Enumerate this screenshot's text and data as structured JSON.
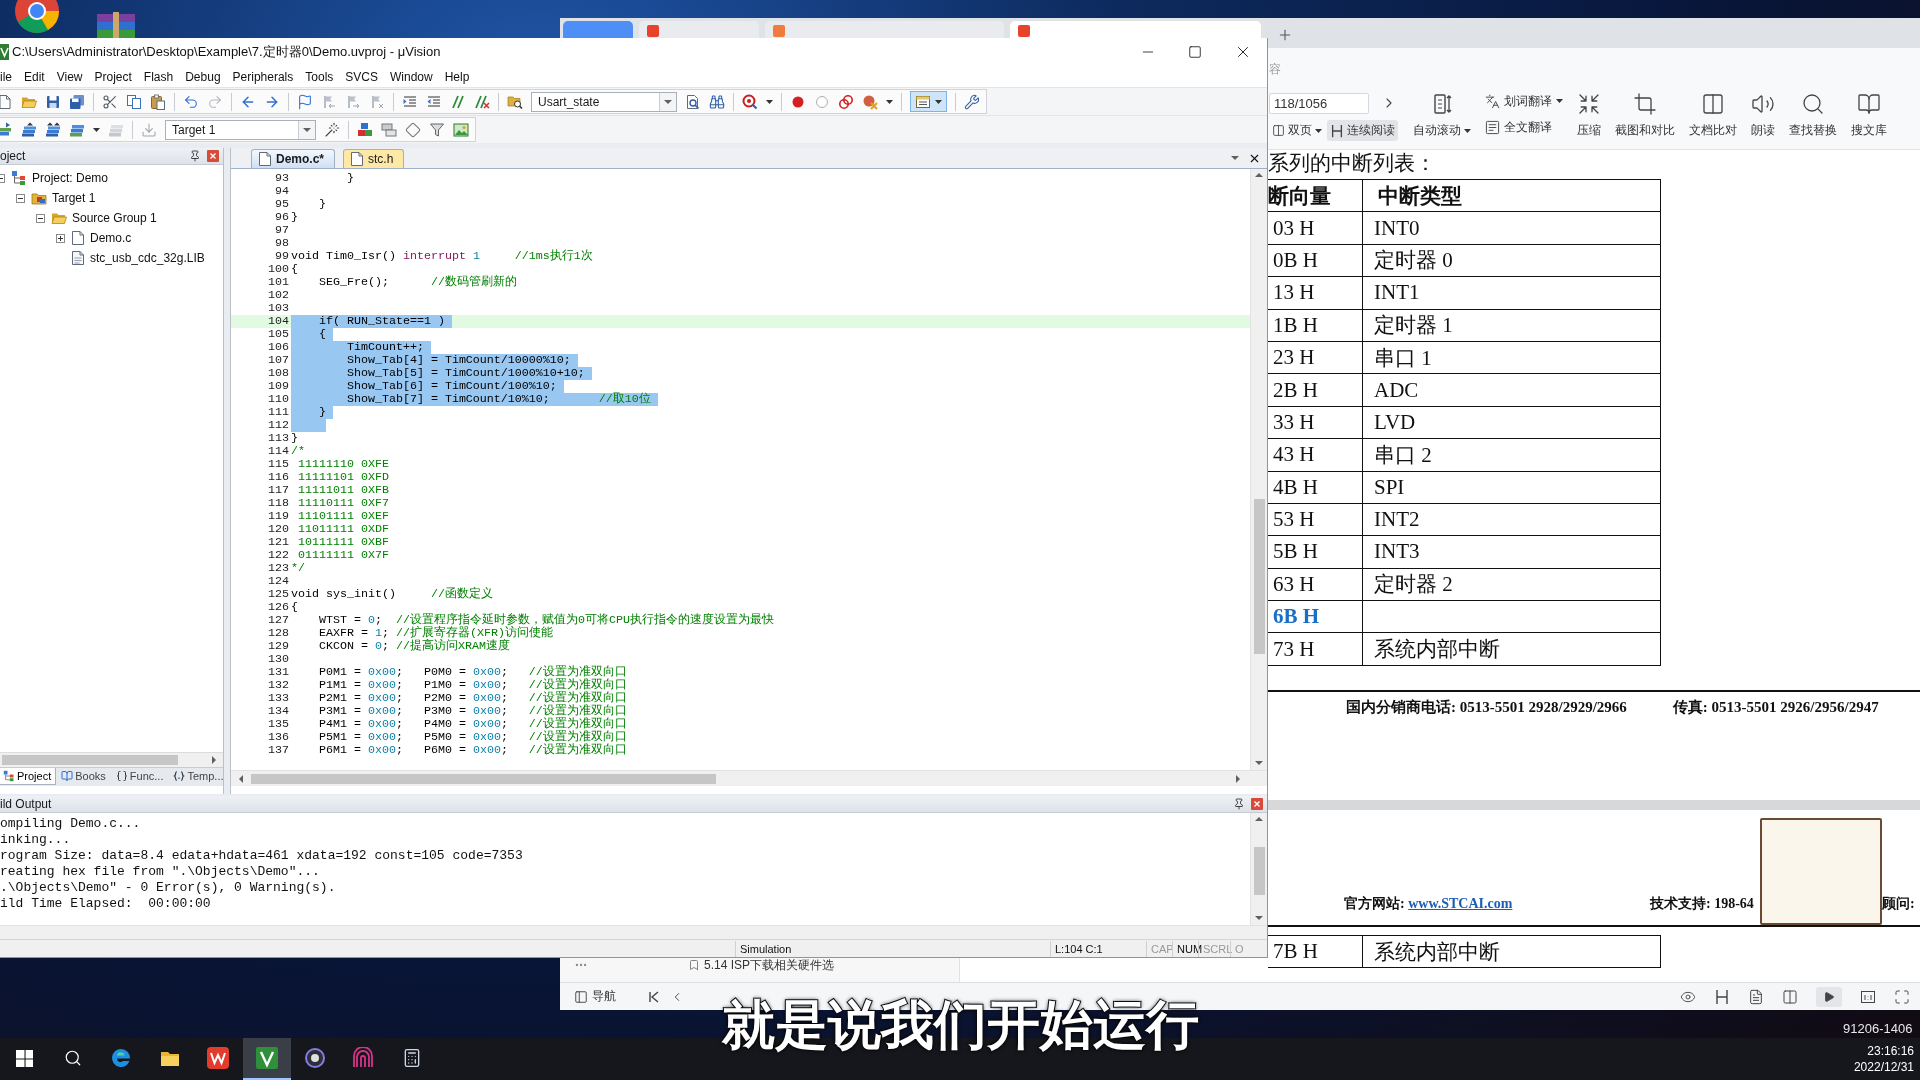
{
  "reader": {
    "tabs": [
      {
        "kind": "home",
        "selected": false
      },
      {
        "kind": "document",
        "color": "#e8412c",
        "selected": false
      },
      {
        "kind": "document",
        "color": "#f07b3f",
        "selected": false
      },
      {
        "kind": "document",
        "color": "#e8412c",
        "selected": true
      }
    ],
    "search_fragment": "容",
    "page_field": {
      "value": "118/1056"
    },
    "view_buttons": [
      {
        "label": "双页",
        "selected": false,
        "menu": true
      },
      {
        "label": "连续阅读",
        "selected": true,
        "menu": false
      }
    ],
    "tools": [
      {
        "kind": "large",
        "label": "自动滚动",
        "menu": true
      },
      {
        "kind": "small",
        "label": "划词翻译",
        "menu": true
      },
      {
        "kind": "small",
        "label": "全文翻译",
        "menu": false
      },
      {
        "kind": "large",
        "label": "压缩",
        "menu": false
      },
      {
        "kind": "large",
        "label": "截图和对比",
        "menu": false
      },
      {
        "kind": "large",
        "label": "文档比对",
        "menu": false
      },
      {
        "kind": "large",
        "label": "朗读",
        "menu": false
      },
      {
        "kind": "large",
        "label": "查找替换",
        "menu": false
      },
      {
        "kind": "large",
        "label": "搜文库",
        "menu": false
      }
    ],
    "outline": {
      "item": "5.14 ISP下载相关硬件选"
    },
    "page": {
      "heading": "系列的中断列表：",
      "columns": [
        "断向量",
        "中断类型"
      ],
      "rows": [
        {
          "vector": "03 H",
          "type": "INT0",
          "link": false
        },
        {
          "vector": "0B H",
          "type": "定时器 0",
          "link": false
        },
        {
          "vector": "13 H",
          "type": "INT1",
          "link": false
        },
        {
          "vector": "1B H",
          "type": "定时器 1",
          "link": false
        },
        {
          "vector": "23 H",
          "type": "串口 1",
          "link": false
        },
        {
          "vector": "2B H",
          "type": "ADC",
          "link": false
        },
        {
          "vector": "33 H",
          "type": "LVD",
          "link": false
        },
        {
          "vector": "43 H",
          "type": "串口 2",
          "link": false
        },
        {
          "vector": "4B H",
          "type": "SPI",
          "link": false
        },
        {
          "vector": "53 H",
          "type": "INT2",
          "link": false
        },
        {
          "vector": "5B H",
          "type": "INT3",
          "link": false
        },
        {
          "vector": "63 H",
          "type": "定时器 2",
          "link": false
        },
        {
          "vector": "6B H",
          "link": true
        },
        {
          "vector": "73 H",
          "type": "系统内部中断",
          "link": false
        }
      ],
      "footer": {
        "phone": "国内分销商电话: 0513-5501 2928/2929/2966",
        "fax": "传真: 0513-5501 2926/2956/2947"
      }
    },
    "next_page": {
      "website": {
        "label": "官方网站:",
        "link": "www.STCAI.com"
      },
      "support": "技术支持: 198-64",
      "advisor": "顾问:",
      "rows": [
        {
          "vector": "7B H",
          "type": "系统内部中断",
          "link": false
        }
      ]
    },
    "bottom_bar": {
      "nav_label": "导航"
    }
  },
  "ide": {
    "title": "C:\\Users\\Administrator\\Desktop\\Example\\7.定时器0\\Demo.uvproj - μVision",
    "menu": [
      "ile",
      "Edit",
      "View",
      "Project",
      "Flash",
      "Debug",
      "Peripherals",
      "Tools",
      "SVCS",
      "Window",
      "Help"
    ],
    "toolbar": {
      "find_combo": "Usart_state",
      "target_combo": "Target 1",
      "layout_button_pressed": true
    },
    "project_panel": {
      "title": "oject",
      "tree": [
        {
          "label": "Project: Demo",
          "kind": "project",
          "expanded": true,
          "children": [
            {
              "label": "Target 1",
              "kind": "target",
              "expanded": true,
              "children": [
                {
                  "label": "Source Group 1",
                  "kind": "group",
                  "expanded": true,
                  "children": [
                    {
                      "label": "Demo.c",
                      "kind": "file",
                      "expanded": false
                    },
                    {
                      "label": "stc_usb_cdc_32g.LIB",
                      "kind": "library"
                    }
                  ]
                }
              ]
            }
          ]
        }
      ],
      "tabs": [
        {
          "label": "Project",
          "kind": "project",
          "selected": true
        },
        {
          "label": "Books",
          "kind": "books",
          "selected": false
        },
        {
          "label": "Func...",
          "kind": "functions",
          "selected": false
        },
        {
          "label": "Temp...",
          "kind": "templates",
          "selected": false
        }
      ]
    },
    "editor": {
      "tabs": [
        {
          "label": "Demo.c*",
          "selected": true
        },
        {
          "label": "stc.h",
          "selected": false
        }
      ],
      "lines": [
        {
          "number": "93",
          "selected": false,
          "current": false,
          "segments": [
            {
              "kind": "plain",
              "text": "        }"
            }
          ]
        },
        {
          "number": "94",
          "selected": false,
          "current": false
        },
        {
          "number": "95",
          "selected": false,
          "current": false,
          "segments": [
            {
              "kind": "plain",
              "text": "    }"
            }
          ]
        },
        {
          "number": "96",
          "selected": false,
          "current": false,
          "segments": [
            {
              "kind": "plain",
              "text": "}"
            }
          ]
        },
        {
          "number": "97",
          "selected": false,
          "current": false
        },
        {
          "number": "98",
          "selected": false,
          "current": false
        },
        {
          "number": "99",
          "selected": false,
          "current": false,
          "segments": [
            {
              "kind": "plain",
              "text": "void Tim0_Isr() "
            },
            {
              "kind": "keyword",
              "text": "interrupt "
            },
            {
              "kind": "number",
              "text": "1     "
            },
            {
              "kind": "comment",
              "text": "//1ms执行1次"
            }
          ]
        },
        {
          "number": "100",
          "selected": false,
          "current": false,
          "segments": [
            {
              "kind": "plain",
              "text": "{"
            }
          ]
        },
        {
          "number": "101",
          "selected": false,
          "current": false,
          "segments": [
            {
              "kind": "plain",
              "text": "    SEG_Fre();      "
            },
            {
              "kind": "comment",
              "text": "//数码管刷新的"
            }
          ]
        },
        {
          "number": "102",
          "selected": false,
          "current": false
        },
        {
          "number": "103",
          "selected": false,
          "current": false
        },
        {
          "number": "104",
          "selected": true,
          "current": true,
          "segments": [
            {
              "kind": "plain",
              "text": "    if( RUN_State==1 )"
            }
          ]
        },
        {
          "number": "105",
          "selected": true,
          "current": false,
          "segments": [
            {
              "kind": "plain",
              "text": "    {"
            }
          ]
        },
        {
          "number": "106",
          "selected": true,
          "current": false,
          "segments": [
            {
              "kind": "plain",
              "text": "        TimCount++;"
            }
          ]
        },
        {
          "number": "107",
          "selected": true,
          "current": false,
          "segments": [
            {
              "kind": "plain",
              "text": "        Show_Tab[4] = TimCount/10000%10;"
            }
          ]
        },
        {
          "number": "108",
          "selected": true,
          "current": false,
          "segments": [
            {
              "kind": "plain",
              "text": "        Show_Tab[5] = TimCount/1000%10+10;"
            }
          ]
        },
        {
          "number": "109",
          "selected": true,
          "current": false,
          "segments": [
            {
              "kind": "plain",
              "text": "        Show_Tab[6] = TimCount/100%10;"
            }
          ]
        },
        {
          "number": "110",
          "selected": true,
          "current": false,
          "segments": [
            {
              "kind": "plain",
              "text": "        Show_Tab[7] = TimCount/10%10;       "
            },
            {
              "kind": "comment",
              "text": "//取10位"
            }
          ]
        },
        {
          "number": "111",
          "selected": true,
          "current": false,
          "segments": [
            {
              "kind": "plain",
              "text": "    }"
            }
          ]
        },
        {
          "number": "112",
          "selected": true,
          "current": false
        },
        {
          "number": "113",
          "selected": false,
          "current": false,
          "segments": [
            {
              "kind": "plain",
              "text": "}"
            }
          ]
        },
        {
          "number": "114",
          "selected": false,
          "current": false,
          "segments": [
            {
              "kind": "comment",
              "text": "/*"
            }
          ]
        },
        {
          "number": "115",
          "selected": false,
          "current": false,
          "segments": [
            {
              "kind": "comment",
              "text": " 11111110 0XFE"
            }
          ]
        },
        {
          "number": "116",
          "selected": false,
          "current": false,
          "segments": [
            {
              "kind": "comment",
              "text": " 11111101 0XFD"
            }
          ]
        },
        {
          "number": "117",
          "selected": false,
          "current": false,
          "segments": [
            {
              "kind": "comment",
              "text": " 11111011 0XFB"
            }
          ]
        },
        {
          "number": "118",
          "selected": false,
          "current": false,
          "segments": [
            {
              "kind": "comment",
              "text": " 11110111 0XF7"
            }
          ]
        },
        {
          "number": "119",
          "selected": false,
          "current": false,
          "segments": [
            {
              "kind": "comment",
              "text": " 11101111 0XEF"
            }
          ]
        },
        {
          "number": "120",
          "selected": false,
          "current": false,
          "segments": [
            {
              "kind": "comment",
              "text": " 11011111 0XDF"
            }
          ]
        },
        {
          "number": "121",
          "selected": false,
          "current": false,
          "segments": [
            {
              "kind": "comment",
              "text": " 10111111 0XBF"
            }
          ]
        },
        {
          "number": "122",
          "selected": false,
          "current": false,
          "segments": [
            {
              "kind": "comment",
              "text": " 01111111 0X7F"
            }
          ]
        },
        {
          "number": "123",
          "selected": false,
          "current": false,
          "segments": [
            {
              "kind": "comment",
              "text": "*/"
            }
          ]
        },
        {
          "number": "124",
          "selected": false,
          "current": false
        },
        {
          "number": "125",
          "selected": false,
          "current": false,
          "segments": [
            {
              "kind": "plain",
              "text": "void sys_init()     "
            },
            {
              "kind": "comment",
              "text": "//函数定义"
            }
          ]
        },
        {
          "number": "126",
          "selected": false,
          "current": false,
          "segments": [
            {
              "kind": "plain",
              "text": "{"
            }
          ]
        },
        {
          "number": "127",
          "selected": false,
          "current": false,
          "segments": [
            {
              "kind": "plain",
              "text": "    WTST = "
            },
            {
              "kind": "number",
              "text": "0"
            },
            {
              "kind": "plain",
              "text": ";  "
            },
            {
              "kind": "comment",
              "text": "//设置程序指令延时参数，赋值为0可将CPU执行指令的速度设置为最快"
            }
          ]
        },
        {
          "number": "128",
          "selected": false,
          "current": false,
          "segments": [
            {
              "kind": "plain",
              "text": "    EAXFR = "
            },
            {
              "kind": "number",
              "text": "1"
            },
            {
              "kind": "plain",
              "text": "; "
            },
            {
              "kind": "comment",
              "text": "//扩展寄存器(XFR)访问使能"
            }
          ]
        },
        {
          "number": "129",
          "selected": false,
          "current": false,
          "segments": [
            {
              "kind": "plain",
              "text": "    CKCON = "
            },
            {
              "kind": "number",
              "text": "0"
            },
            {
              "kind": "plain",
              "text": "; "
            },
            {
              "kind": "comment",
              "text": "//提高访问XRAM速度"
            }
          ]
        },
        {
          "number": "130",
          "selected": false,
          "current": false
        },
        {
          "number": "131",
          "selected": false,
          "current": false,
          "segments": [
            {
              "kind": "plain",
              "text": "    P0M1 = "
            },
            {
              "kind": "number",
              "text": "0x00"
            },
            {
              "kind": "plain",
              "text": ";   P0M0 = "
            },
            {
              "kind": "number",
              "text": "0x00"
            },
            {
              "kind": "plain",
              "text": ";   "
            },
            {
              "kind": "comment",
              "text": "//设置为准双向口"
            }
          ]
        },
        {
          "number": "132",
          "selected": false,
          "current": false,
          "segments": [
            {
              "kind": "plain",
              "text": "    P1M1 = "
            },
            {
              "kind": "number",
              "text": "0x00"
            },
            {
              "kind": "plain",
              "text": ";   P1M0 = "
            },
            {
              "kind": "number",
              "text": "0x00"
            },
            {
              "kind": "plain",
              "text": ";   "
            },
            {
              "kind": "comment",
              "text": "//设置为准双向口"
            }
          ]
        },
        {
          "number": "133",
          "selected": false,
          "current": false,
          "segments": [
            {
              "kind": "plain",
              "text": "    P2M1 = "
            },
            {
              "kind": "number",
              "text": "0x00"
            },
            {
              "kind": "plain",
              "text": ";   P2M0 = "
            },
            {
              "kind": "number",
              "text": "0x00"
            },
            {
              "kind": "plain",
              "text": ";   "
            },
            {
              "kind": "comment",
              "text": "//设置为准双向口"
            }
          ]
        },
        {
          "number": "134",
          "selected": false,
          "current": false,
          "segments": [
            {
              "kind": "plain",
              "text": "    P3M1 = "
            },
            {
              "kind": "number",
              "text": "0x00"
            },
            {
              "kind": "plain",
              "text": ";   P3M0 = "
            },
            {
              "kind": "number",
              "text": "0x00"
            },
            {
              "kind": "plain",
              "text": ";   "
            },
            {
              "kind": "comment",
              "text": "//设置为准双向口"
            }
          ]
        },
        {
          "number": "135",
          "selected": false,
          "current": false,
          "segments": [
            {
              "kind": "plain",
              "text": "    P4M1 = "
            },
            {
              "kind": "number",
              "text": "0x00"
            },
            {
              "kind": "plain",
              "text": ";   P4M0 = "
            },
            {
              "kind": "number",
              "text": "0x00"
            },
            {
              "kind": "plain",
              "text": ";   "
            },
            {
              "kind": "comment",
              "text": "//设置为准双向口"
            }
          ]
        },
        {
          "number": "136",
          "selected": false,
          "current": false,
          "segments": [
            {
              "kind": "plain",
              "text": "    P5M1 = "
            },
            {
              "kind": "number",
              "text": "0x00"
            },
            {
              "kind": "plain",
              "text": ";   P5M0 = "
            },
            {
              "kind": "number",
              "text": "0x00"
            },
            {
              "kind": "plain",
              "text": ";   "
            },
            {
              "kind": "comment",
              "text": "//设置为准双向口"
            }
          ]
        },
        {
          "number": "137",
          "selected": false,
          "current": false,
          "segments": [
            {
              "kind": "plain",
              "text": "    P6M1 = "
            },
            {
              "kind": "number",
              "text": "0x00"
            },
            {
              "kind": "plain",
              "text": ";   P6M0 = "
            },
            {
              "kind": "number",
              "text": "0x00"
            },
            {
              "kind": "plain",
              "text": ";   "
            },
            {
              "kind": "comment",
              "text": "//设置为准双向口"
            }
          ]
        }
      ]
    },
    "build_output": {
      "title": "ild Output",
      "lines": [
        "ompiling Demo.c...",
        "inking...",
        "rogram Size: data=8.4 edata+hdata=461 xdata=192 const=105 code=7353",
        "reating hex file from \".\\Objects\\Demo\"...",
        ".\\Objects\\Demo\" - 0 Error(s), 0 Warning(s).",
        "ild Time Elapsed:  00:00:00"
      ]
    },
    "status_bar": {
      "mode": "Simulation",
      "cursor": "L:104 C:1",
      "indicators": [
        {
          "label": "CAP",
          "on": false
        },
        {
          "label": "NUM",
          "on": true
        },
        {
          "label": "SCRL",
          "on": false
        },
        {
          "label": "O",
          "on": false
        }
      ]
    }
  },
  "subtitle": "就是说我们开始运行",
  "taskbar": {
    "apps": [
      {
        "kind": "start",
        "active": false
      },
      {
        "kind": "search",
        "active": false
      },
      {
        "kind": "browser",
        "active": false
      },
      {
        "kind": "folder",
        "active": false
      },
      {
        "kind": "office",
        "active": false
      },
      {
        "kind": "ide",
        "active": true
      },
      {
        "kind": "ring",
        "active": false
      },
      {
        "kind": "stripes",
        "active": false
      },
      {
        "kind": "calculator",
        "active": false
      }
    ],
    "build": "91206-1406",
    "time": "23:16:16",
    "date": "2022/12/31"
  }
}
